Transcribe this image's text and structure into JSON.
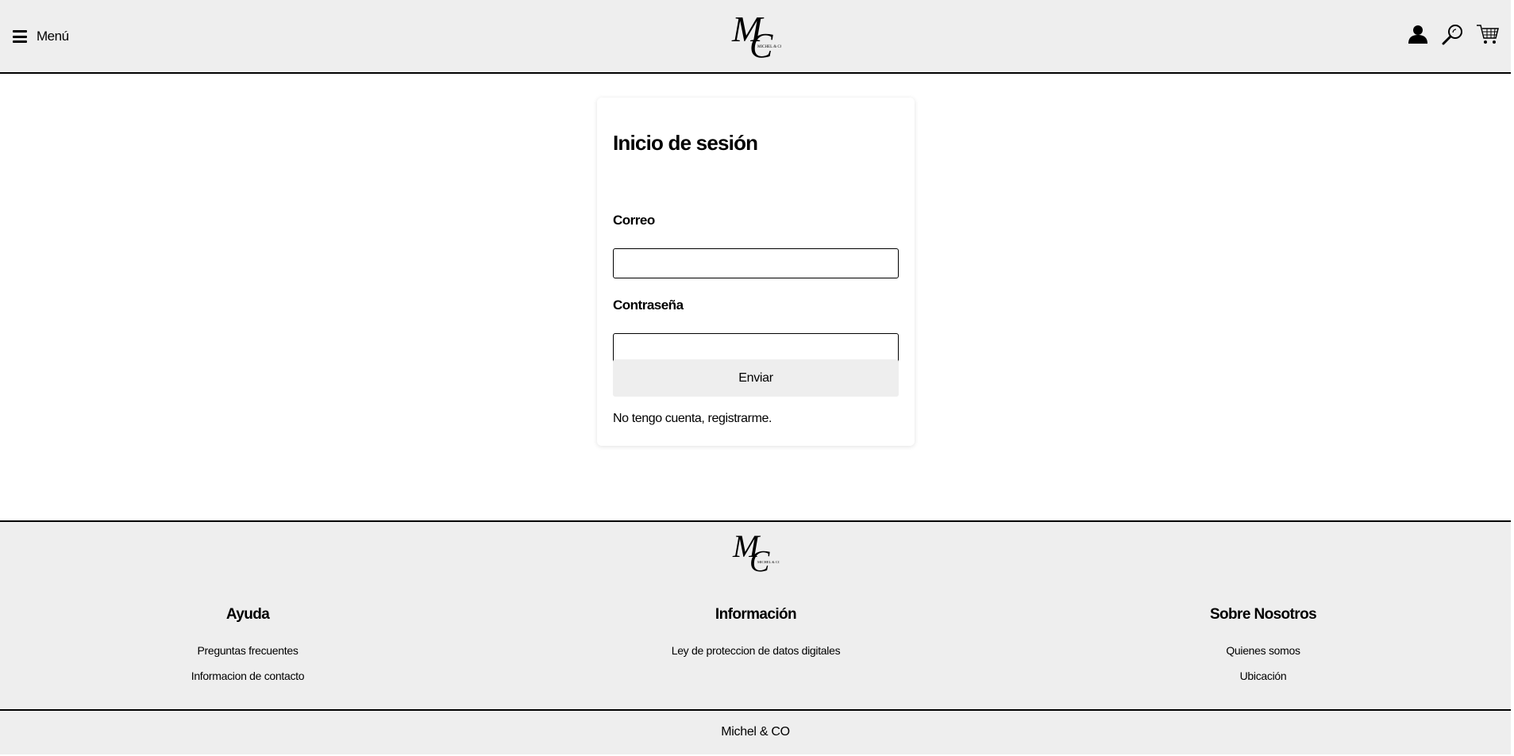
{
  "header": {
    "menu_label": "Menú",
    "logo_text": "Michel & CO",
    "icons": [
      "user-icon",
      "search-icon",
      "cart-icon"
    ]
  },
  "login": {
    "title": "Inicio de sesión",
    "email_label": "Correo",
    "email_value": "",
    "password_label": "Contraseña",
    "password_value": "",
    "submit_label": "Enviar",
    "register_link": "No tengo cuenta, registrarme."
  },
  "footer": {
    "columns": [
      {
        "title": "Ayuda",
        "links": [
          "Preguntas frecuentes",
          "Informacion de contacto"
        ]
      },
      {
        "title": "Información",
        "links": [
          "Ley de proteccion de datos digitales"
        ]
      },
      {
        "title": "Sobre Nosotros",
        "links": [
          "Quienes somos",
          "Ubicación"
        ]
      }
    ],
    "copyright": "Michel & CO"
  }
}
